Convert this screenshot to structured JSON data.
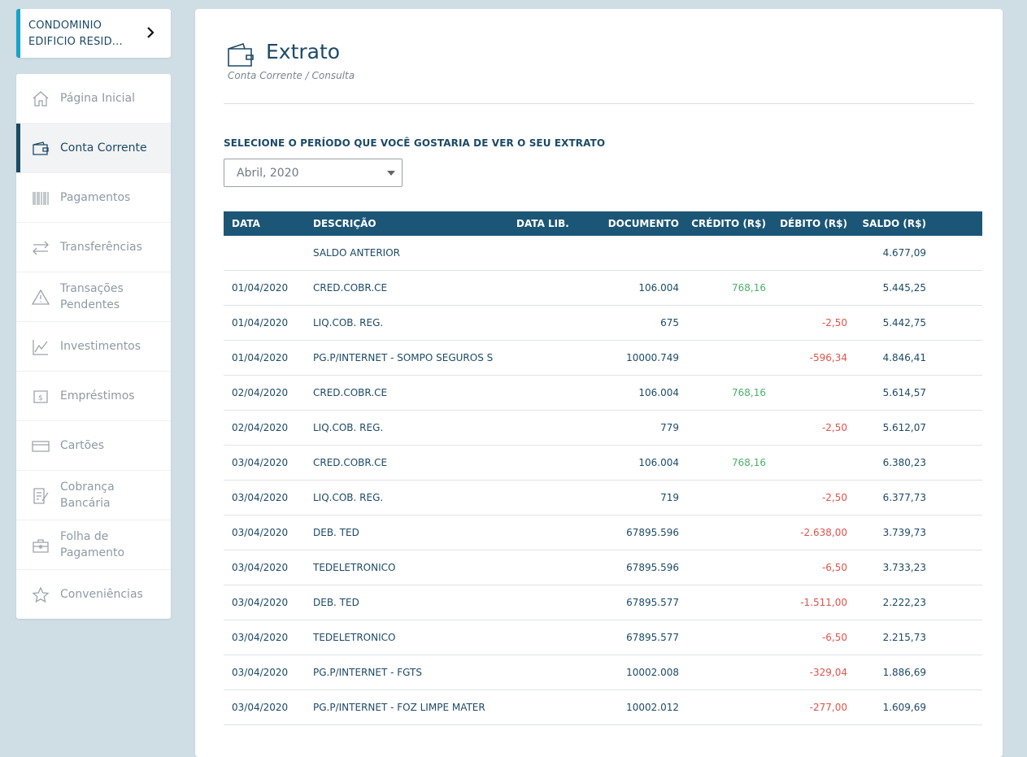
{
  "account": {
    "name": "CONDOMINIO EDIFICIO RESID..."
  },
  "sidebar": {
    "items": [
      {
        "label": "Página Inicial",
        "icon": "home-icon"
      },
      {
        "label": "Conta Corrente",
        "icon": "wallet-icon",
        "active": true
      },
      {
        "label": "Pagamentos",
        "icon": "barcode-icon"
      },
      {
        "label": "Transferências",
        "icon": "transfer-arrows-icon"
      },
      {
        "label": "Transações Pendentes",
        "icon": "warning-icon"
      },
      {
        "label": "Investimentos",
        "icon": "chart-line-icon"
      },
      {
        "label": "Empréstimos",
        "icon": "money-icon"
      },
      {
        "label": "Cartões",
        "icon": "credit-card-icon"
      },
      {
        "label": "Cobrança Bancária",
        "icon": "document-edit-icon"
      },
      {
        "label": "Folha de Pagamento",
        "icon": "briefcase-icon"
      },
      {
        "label": "Conveniências",
        "icon": "star-icon"
      }
    ]
  },
  "header": {
    "title": "Extrato",
    "breadcrumb": "Conta Corrente / Consulta",
    "icon": "wallet-icon"
  },
  "period": {
    "label": "SELECIONE O PERÍODO QUE VOCÊ GOSTARIA DE VER O SEU EXTRATO",
    "selected": "Abril, 2020"
  },
  "table": {
    "columns": [
      "DATA",
      "DESCRIÇÃO",
      "DATA LIB.",
      "DOCUMENTO",
      "CRÉDITO (R$)",
      "DÉBITO (R$)",
      "SALDO (R$)"
    ],
    "rows": [
      {
        "date": "",
        "desc": "SALDO ANTERIOR",
        "lib": "",
        "doc": "",
        "credit": "",
        "debit": "",
        "balance": "4.677,09"
      },
      {
        "date": "01/04/2020",
        "desc": "CRED.COBR.CE",
        "lib": "",
        "doc": "106.004",
        "credit": "768,16",
        "debit": "",
        "balance": "5.445,25"
      },
      {
        "date": "01/04/2020",
        "desc": "LIQ.COB. REG.",
        "lib": "",
        "doc": "675",
        "credit": "",
        "debit": "-2,50",
        "balance": "5.442,75"
      },
      {
        "date": "01/04/2020",
        "desc": "PG.P/INTERNET - SOMPO SEGUROS S",
        "lib": "",
        "doc": "10000.749",
        "credit": "",
        "debit": "-596,34",
        "balance": "4.846,41"
      },
      {
        "date": "02/04/2020",
        "desc": "CRED.COBR.CE",
        "lib": "",
        "doc": "106.004",
        "credit": "768,16",
        "debit": "",
        "balance": "5.614,57"
      },
      {
        "date": "02/04/2020",
        "desc": "LIQ.COB. REG.",
        "lib": "",
        "doc": "779",
        "credit": "",
        "debit": "-2,50",
        "balance": "5.612,07"
      },
      {
        "date": "03/04/2020",
        "desc": "CRED.COBR.CE",
        "lib": "",
        "doc": "106.004",
        "credit": "768,16",
        "debit": "",
        "balance": "6.380,23"
      },
      {
        "date": "03/04/2020",
        "desc": "LIQ.COB. REG.",
        "lib": "",
        "doc": "719",
        "credit": "",
        "debit": "-2,50",
        "balance": "6.377,73"
      },
      {
        "date": "03/04/2020",
        "desc": "DEB. TED",
        "lib": "",
        "doc": "67895.596",
        "credit": "",
        "debit": "-2.638,00",
        "balance": "3.739,73"
      },
      {
        "date": "03/04/2020",
        "desc": "TEDELETRONICO",
        "lib": "",
        "doc": "67895.596",
        "credit": "",
        "debit": "-6,50",
        "balance": "3.733,23"
      },
      {
        "date": "03/04/2020",
        "desc": "DEB. TED",
        "lib": "",
        "doc": "67895.577",
        "credit": "",
        "debit": "-1.511,00",
        "balance": "2.222,23"
      },
      {
        "date": "03/04/2020",
        "desc": "TEDELETRONICO",
        "lib": "",
        "doc": "67895.577",
        "credit": "",
        "debit": "-6,50",
        "balance": "2.215,73"
      },
      {
        "date": "03/04/2020",
        "desc": "PG.P/INTERNET - FGTS",
        "lib": "",
        "doc": "10002.008",
        "credit": "",
        "debit": "-329,04",
        "balance": "1.886,69"
      },
      {
        "date": "03/04/2020",
        "desc": "PG.P/INTERNET - FOZ LIMPE MATER",
        "lib": "",
        "doc": "10002.012",
        "credit": "",
        "debit": "-277,00",
        "balance": "1.609,69"
      }
    ]
  },
  "colors": {
    "navy": "#1c4a67",
    "header_bg": "#1c5676",
    "accent": "#1aa3c9",
    "credit": "#4db06a",
    "debit": "#e0524b",
    "page_bg": "#cfdde5"
  }
}
